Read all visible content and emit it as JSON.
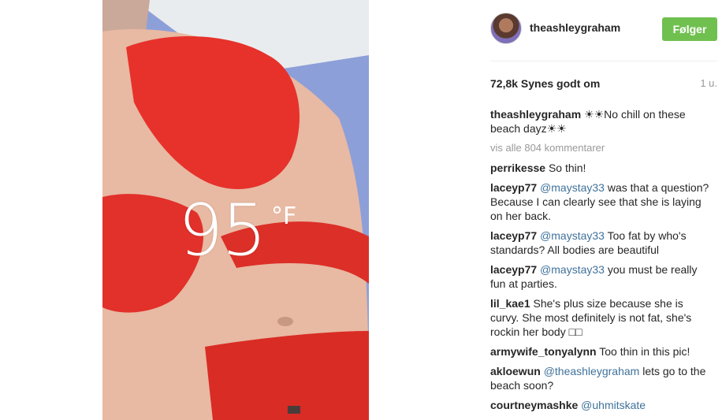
{
  "photo": {
    "temperature": "95",
    "unit": "°F"
  },
  "post": {
    "username": "theashleygraham",
    "follow_label": "Følger",
    "likes": "72,8k Synes godt om",
    "time_ago": "1 u.",
    "caption_user": "theashleygraham",
    "caption_text": "☀☀No chill on these beach dayz☀☀",
    "view_all": "vis alle 804 kommentarer"
  },
  "comments": [
    {
      "user": "perrikesse",
      "mention": "",
      "text": "So thin!"
    },
    {
      "user": "laceyp77",
      "mention": "@maystay33",
      "text": "was that a question? Because I can clearly see that she is laying on her back."
    },
    {
      "user": "laceyp77",
      "mention": "@maystay33",
      "text": "Too fat by who's standards? All bodies are beautiful"
    },
    {
      "user": "laceyp77",
      "mention": "@maystay33",
      "text": "you must be really fun at parties."
    },
    {
      "user": "lil_kae1",
      "mention": "",
      "text": "She's plus size because she is curvy. She most definitely is not fat, she's rockin her body □□"
    },
    {
      "user": "armywife_tonyalynn",
      "mention": "",
      "text": "Too thin in this pic!"
    },
    {
      "user": "akloewun",
      "mention": "@theashleygraham",
      "text": "lets go to the beach soon?"
    },
    {
      "user": "courtneymashke",
      "mention": "@uhmitskate",
      "text": ""
    }
  ]
}
